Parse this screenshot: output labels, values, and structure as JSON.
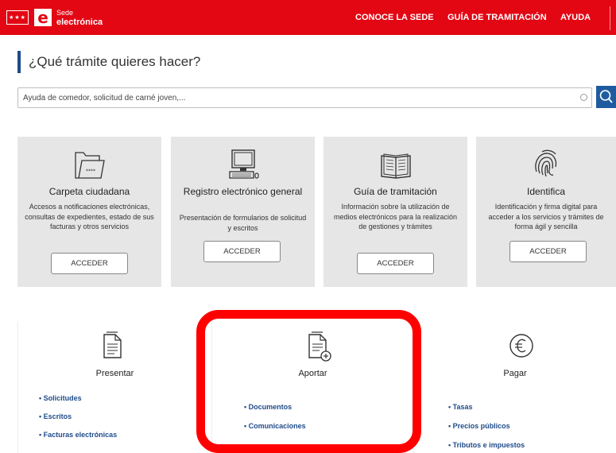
{
  "header": {
    "logo_mark": "e",
    "logo_line1": "Sede",
    "logo_line2": "electrónica",
    "nav": [
      "CONOCE LA SEDE",
      "GUÍA DE TRAMITACIÓN",
      "AYUDA"
    ],
    "brand_color": "#e30613"
  },
  "main": {
    "title": "¿Qué trámite quieres hacer?",
    "search_placeholder": "Ayuda de comedor, solicitud de carné joven,..."
  },
  "cards": [
    {
      "title": "Carpeta ciudadana",
      "desc": "Accesos a notificaciones electrónicas, consultas de expedientes, estado de sus facturas y otros servicios",
      "button": "ACCEDER",
      "icon": "folder-icon"
    },
    {
      "title": "Registro electrónico general",
      "desc": "Presentación de formularios de solicitud y escritos",
      "button": "ACCEDER",
      "icon": "computer-icon"
    },
    {
      "title": "Guía de tramitación",
      "desc": "Información sobre la utilización de medios electrónicos para la realización de gestiones y trámites",
      "button": "ACCEDER",
      "icon": "book-icon"
    },
    {
      "title": "Identifica",
      "desc": "Identificación y firma digital para acceder a los servicios y trámites de forma ágil y sencilla",
      "button": "ACCEDER",
      "icon": "fingerprint-icon"
    }
  ],
  "panels": [
    {
      "title": "Presentar",
      "icon": "document-icon",
      "links": [
        "• Solicitudes",
        "• Escritos",
        "• Facturas electrónicas"
      ]
    },
    {
      "title": "Aportar",
      "icon": "document-add-icon",
      "links": [
        "• Documentos",
        "• Comunicaciones"
      ]
    },
    {
      "title": "Pagar",
      "icon": "euro-icon",
      "links": [
        "• Tasas",
        "• Precios públicos",
        "• Tributos e impuestos"
      ]
    }
  ],
  "colors": {
    "link": "#1f4b8a",
    "search_button": "#1f5c9f",
    "highlight": "#ff0000",
    "card_bg": "#e6e6e6"
  }
}
